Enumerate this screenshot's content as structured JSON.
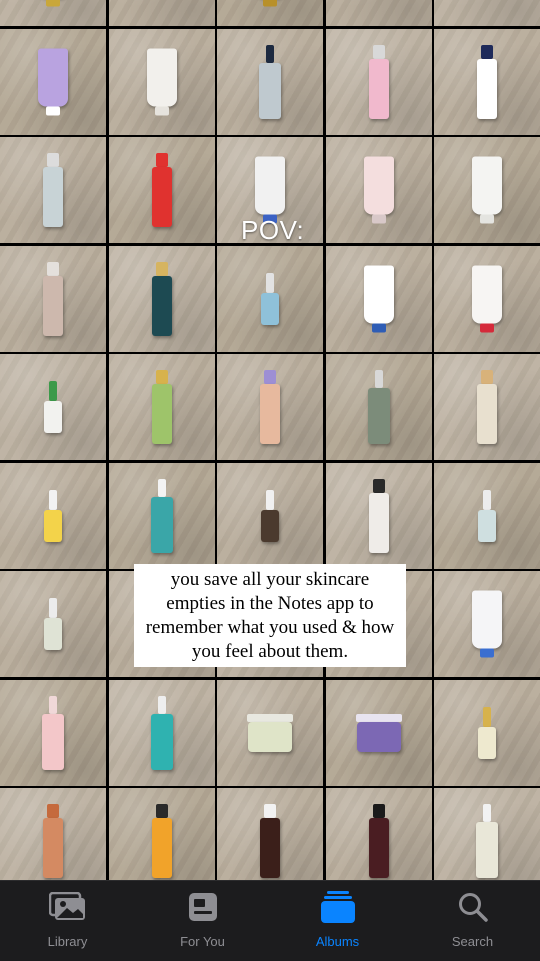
{
  "overlay": {
    "pov": "POV:",
    "caption": "you save all your skincare empties in the Notes app to remember what you used & how you feel about them."
  },
  "tabs": [
    {
      "label": "Library",
      "icon": "photo-library-icon",
      "active": false
    },
    {
      "label": "For You",
      "icon": "for-you-icon",
      "active": false
    },
    {
      "label": "Albums",
      "icon": "albums-icon",
      "active": true
    },
    {
      "label": "Search",
      "icon": "search-icon",
      "active": false
    }
  ],
  "colors": {
    "tab_active": "#0a84ff",
    "tab_inactive": "#8e8e93",
    "tabbar_bg": "#1c1c1e"
  },
  "products": [
    {
      "type": "tube",
      "body": "#d9c25a",
      "cap": "#c9a73a"
    },
    {
      "type": "none"
    },
    {
      "type": "tube",
      "body": "#d9c25a",
      "cap": "#b8902a"
    },
    {
      "type": "none"
    },
    {
      "type": "none"
    },
    {
      "type": "tube",
      "body": "#b9a3e0",
      "cap": "#ffffff"
    },
    {
      "type": "tube",
      "body": "#f2f0ec",
      "cap": "#e6e3dd"
    },
    {
      "type": "pump",
      "body": "#bfc9cf",
      "cap": "#1d2a40"
    },
    {
      "type": "bottle",
      "body": "#f1b9cd",
      "cap": "#d8d8d8"
    },
    {
      "type": "bottle",
      "body": "#ffffff",
      "cap": "#1e2a5a"
    },
    {
      "type": "bottle",
      "body": "#c8d3d6",
      "cap": "#dcdcdc"
    },
    {
      "type": "bottle",
      "body": "#e0322f",
      "cap": "#e0322f"
    },
    {
      "type": "tube",
      "body": "#f1f1f1",
      "cap": "#3b62c4"
    },
    {
      "type": "tube",
      "body": "#f4dede",
      "cap": "#d8c8c8"
    },
    {
      "type": "tube",
      "body": "#f4f4f2",
      "cap": "#e4e4e0"
    },
    {
      "type": "bottle",
      "body": "#cdb8ad",
      "cap": "#e4e0dc"
    },
    {
      "type": "bottle",
      "body": "#1d4a52",
      "cap": "#d6b460"
    },
    {
      "type": "dropper",
      "body": "#8fc1d9",
      "cap": "#e2e2e2"
    },
    {
      "type": "tube",
      "body": "#ffffff",
      "cap": "#2f5db5"
    },
    {
      "type": "tube",
      "body": "#f7f5f3",
      "cap": "#d52a3a"
    },
    {
      "type": "dropper",
      "body": "#f2f2ef",
      "cap": "#3c9a4a"
    },
    {
      "type": "bottle",
      "body": "#9ec46a",
      "cap": "#d7b24c"
    },
    {
      "type": "bottle",
      "body": "#e7b99e",
      "cap": "#9d8fd4"
    },
    {
      "type": "pump",
      "body": "#7c8c7a",
      "cap": "#d8d8d8"
    },
    {
      "type": "bottle",
      "body": "#e8e0cf",
      "cap": "#d8b27a"
    },
    {
      "type": "dropper",
      "body": "#f3d34a",
      "cap": "#f2f2f2"
    },
    {
      "type": "pump",
      "body": "#3aa6a8",
      "cap": "#f3f3f3"
    },
    {
      "type": "dropper",
      "body": "#4b3a2e",
      "cap": "#f0f0f0"
    },
    {
      "type": "bottle",
      "body": "#efece8",
      "cap": "#2a2a2a"
    },
    {
      "type": "dropper",
      "body": "#cfdfe0",
      "cap": "#ececec"
    },
    {
      "type": "dropper",
      "body": "#dfe3d5",
      "cap": "#ececec"
    },
    {
      "type": "none"
    },
    {
      "type": "none"
    },
    {
      "type": "none"
    },
    {
      "type": "tube",
      "body": "#f5f5f7",
      "cap": "#3a6ed0"
    },
    {
      "type": "pump",
      "body": "#f3c7c9",
      "cap": "#f0d8d8"
    },
    {
      "type": "pump",
      "body": "#2fb2b0",
      "cap": "#eeeeee"
    },
    {
      "type": "jar",
      "body": "#dfe4c8",
      "cap": "#e8e8e0"
    },
    {
      "type": "jar",
      "body": "#7c68b4",
      "cap": "#e8e4f0"
    },
    {
      "type": "dropper",
      "body": "#eee9cf",
      "cap": "#d7b24c"
    },
    {
      "type": "bottle",
      "body": "#d48a62",
      "cap": "#c56a3d"
    },
    {
      "type": "bottle",
      "body": "#f1a32a",
      "cap": "#2a2a2a"
    },
    {
      "type": "bottle",
      "body": "#3b1f1a",
      "cap": "#f2f2f2"
    },
    {
      "type": "bottle",
      "body": "#4a1d22",
      "cap": "#1a1a1a"
    },
    {
      "type": "pump",
      "body": "#e9e7d8",
      "cap": "#f2f2f2"
    }
  ]
}
